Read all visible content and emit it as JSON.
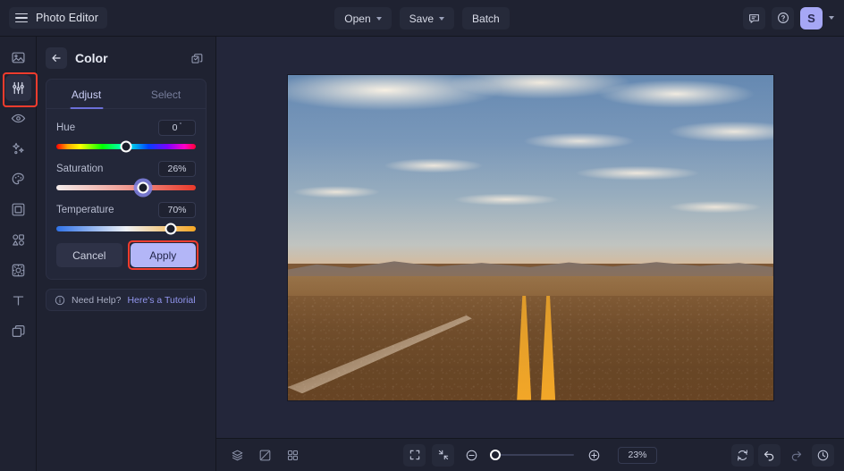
{
  "app": {
    "title": "Photo Editor",
    "menu_icon": "hamburger-icon"
  },
  "topbar": {
    "open_label": "Open",
    "save_label": "Save",
    "batch_label": "Batch",
    "feedback_icon": "chat-icon",
    "help_icon": "question-circle-icon",
    "avatar_initial": "S"
  },
  "sidebar": {
    "items": [
      {
        "name": "image",
        "icon": "image-icon",
        "active": false
      },
      {
        "name": "adjust",
        "icon": "sliders-icon",
        "active": true
      },
      {
        "name": "retouch",
        "icon": "eye-icon",
        "active": false
      },
      {
        "name": "effects",
        "icon": "sparkle-icon",
        "active": false
      },
      {
        "name": "paint",
        "icon": "palette-icon",
        "active": false
      },
      {
        "name": "frame",
        "icon": "frame-icon",
        "active": false
      },
      {
        "name": "shapes",
        "icon": "shapes-icon",
        "active": false
      },
      {
        "name": "stickers",
        "icon": "sticker-icon",
        "active": false
      },
      {
        "name": "text",
        "icon": "text-icon",
        "active": false
      },
      {
        "name": "layers",
        "icon": "layers-icon",
        "active": false
      }
    ]
  },
  "panel": {
    "back_icon": "arrow-left-icon",
    "title": "Color",
    "duplicate_icon": "copy-icon",
    "tabs": [
      {
        "label": "Adjust",
        "active": true
      },
      {
        "label": "Select",
        "active": false
      }
    ],
    "sliders": [
      {
        "label": "Hue",
        "value": "0",
        "unit": "°",
        "percent": 50,
        "type": "hue",
        "focused": false
      },
      {
        "label": "Saturation",
        "value": "26%",
        "unit": "",
        "percent": 62,
        "type": "saturation",
        "focused": true
      },
      {
        "label": "Temperature",
        "value": "70%",
        "unit": "",
        "percent": 82,
        "type": "temperature",
        "focused": false
      }
    ],
    "cancel_label": "Cancel",
    "apply_label": "Apply",
    "help_icon": "info-icon",
    "help_text": "Need Help?",
    "help_link": "Here's a Tutorial"
  },
  "bottombar": {
    "left_tools": [
      {
        "name": "layers",
        "icon": "layers-stack-icon"
      },
      {
        "name": "compare",
        "icon": "compare-icon"
      },
      {
        "name": "grid",
        "icon": "grid-icon"
      }
    ],
    "fit_icon": "fit-screen-icon",
    "collapse_icon": "collapse-icon",
    "zoom_out_icon": "minus-circle-icon",
    "zoom_in_icon": "plus-circle-icon",
    "zoom_level": "23%",
    "right_tools": [
      {
        "name": "reset",
        "icon": "reset-icon"
      },
      {
        "name": "undo",
        "icon": "undo-icon"
      },
      {
        "name": "redo",
        "icon": "redo-icon"
      },
      {
        "name": "history",
        "icon": "history-icon"
      }
    ]
  },
  "colors": {
    "accent": "#b3b6f7",
    "link": "#9296ef",
    "annotation": "#f33c2d",
    "panel_bg": "#1f2231",
    "canvas_bg": "#23263a"
  }
}
